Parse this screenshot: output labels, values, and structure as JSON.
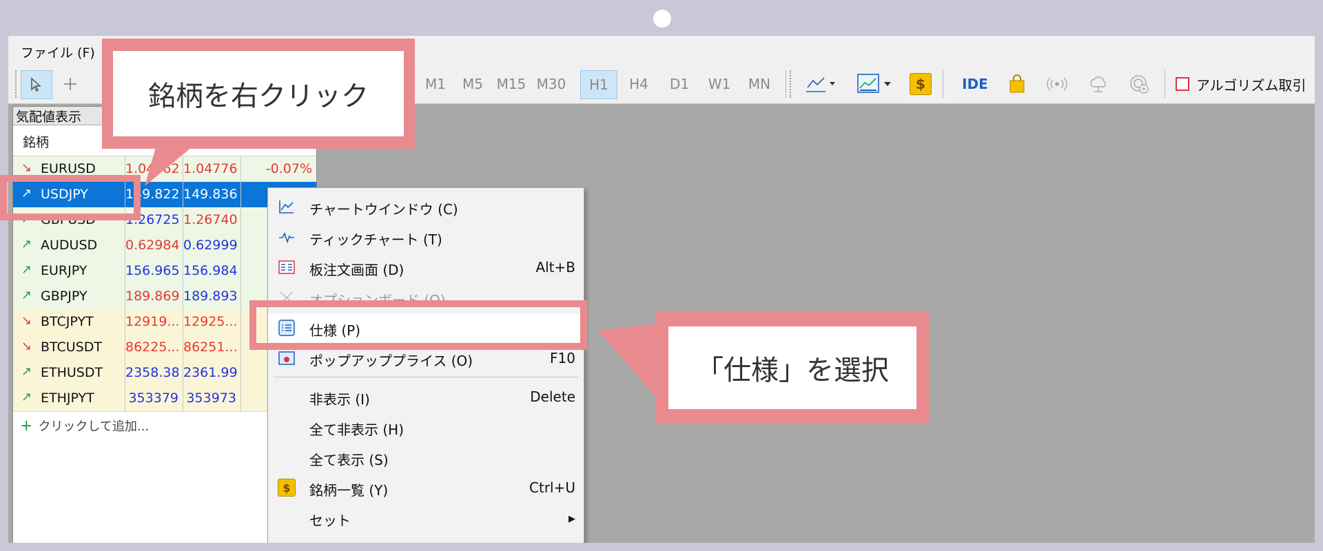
{
  "menubar": {
    "file": "ファイル (F)"
  },
  "toolbar": {
    "timeframes": [
      "M1",
      "M5",
      "M15",
      "M30",
      "H1",
      "H4",
      "D1",
      "W1",
      "MN"
    ],
    "active_timeframe": "H1",
    "ide": "IDE",
    "algo_trading": "アルゴリズム取引",
    "dollar": "$"
  },
  "panel": {
    "title": "気配値表示",
    "col_symbol": "銘柄",
    "rows": [
      {
        "symbol": "EURUSD",
        "bid": "1.04762",
        "ask": "1.04776",
        "change": "-0.07%"
      },
      {
        "symbol": "USDJPY",
        "bid": "149.822",
        "ask": "149.836",
        "change": ""
      },
      {
        "symbol": "GBPUSD",
        "bid": "1.26725",
        "ask": "1.26740",
        "change": ""
      },
      {
        "symbol": "AUDUSD",
        "bid": "0.62984",
        "ask": "0.62999",
        "change": ""
      },
      {
        "symbol": "EURJPY",
        "bid": "156.965",
        "ask": "156.984",
        "change": ""
      },
      {
        "symbol": "GBPJPY",
        "bid": "189.869",
        "ask": "189.893",
        "change": ""
      },
      {
        "symbol": "BTCJPYT",
        "bid": "12919...",
        "ask": "12925...",
        "change": ""
      },
      {
        "symbol": "BTCUSDT",
        "bid": "86225...",
        "ask": "86251...",
        "change": ""
      },
      {
        "symbol": "ETHUSDT",
        "bid": "2358.38",
        "ask": "2361.99",
        "change": ""
      },
      {
        "symbol": "ETHJPYT",
        "bid": "353379",
        "ask": "353973",
        "change": ""
      }
    ],
    "add": "クリックして追加..."
  },
  "context_menu": {
    "chart_window": "チャートウインドウ (C)",
    "tick_chart": "ティックチャート (T)",
    "depth": "板注文画面 (D)",
    "depth_shortcut": "Alt+B",
    "option_board": "オプションボード (O)",
    "specification": "仕様 (P)",
    "popup_prices": "ポップアッププライス (O)",
    "popup_shortcut": "F10",
    "hide": "非表示 (I)",
    "hide_shortcut": "Delete",
    "hide_all": "全て非表示 (H)",
    "show_all": "全て表示 (S)",
    "symbols": "銘柄一覧 (Y)",
    "symbols_shortcut": "Ctrl+U",
    "set": "セット"
  },
  "callouts": {
    "right_click": "銘柄を右クリック",
    "select_spec": "「仕様」を選択"
  }
}
